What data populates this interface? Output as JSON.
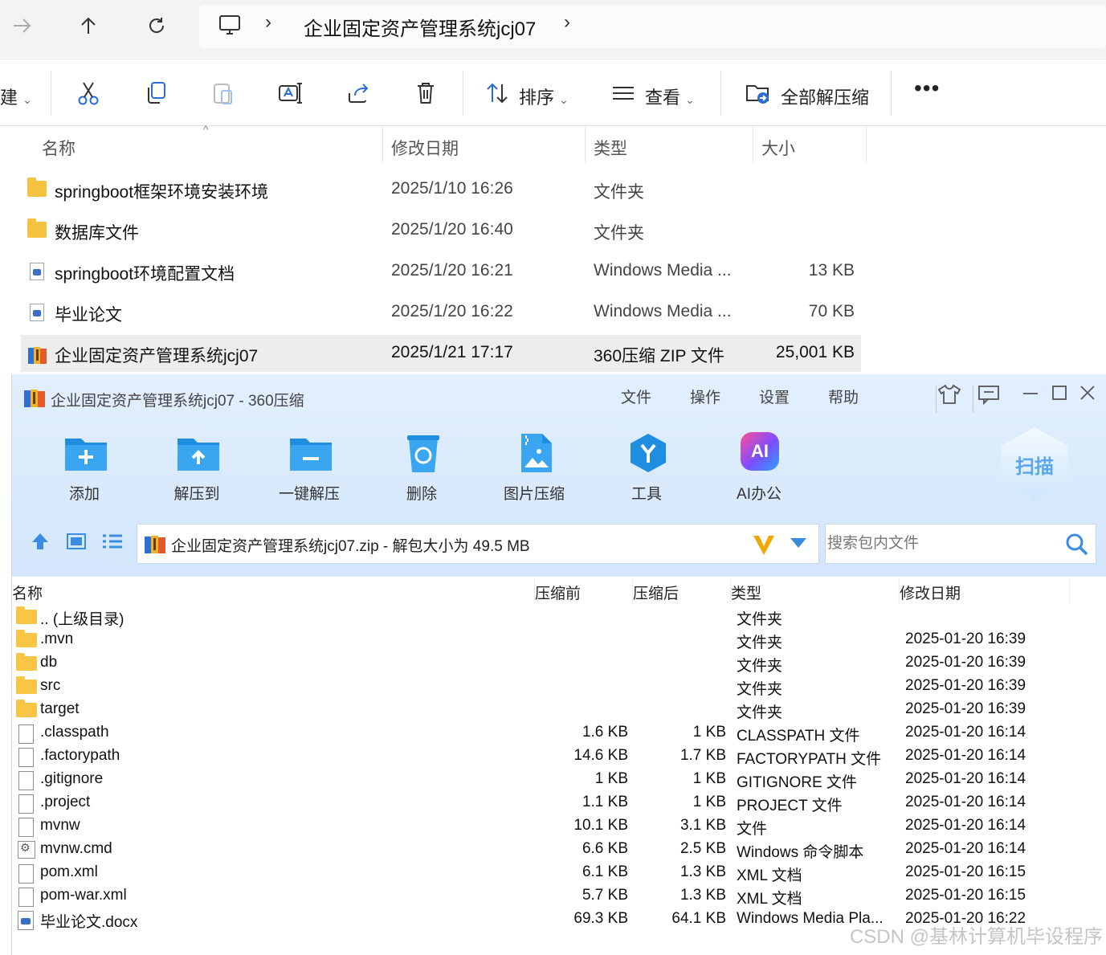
{
  "explorer": {
    "breadcrumb": "企业固定资产管理系统jcj07",
    "toolbar": {
      "new_fragment": "建",
      "sort_label": "排序",
      "view_label": "查看",
      "extract_all_label": "全部解压缩"
    },
    "columns": {
      "name": "名称",
      "modified": "修改日期",
      "type": "类型",
      "size": "大小"
    },
    "rows": [
      {
        "name": "springboot框架环境安装环境",
        "date": "2025/1/10 16:26",
        "type": "文件夹",
        "size": "",
        "icon": "folder-icon"
      },
      {
        "name": "数据库文件",
        "date": "2025/1/20 16:40",
        "type": "文件夹",
        "size": "",
        "icon": "folder-icon"
      },
      {
        "name": "springboot环境配置文档",
        "date": "2025/1/20 16:21",
        "type": "Windows Media ...",
        "size": "13 KB",
        "icon": "document-icon"
      },
      {
        "name": "毕业论文",
        "date": "2025/1/20 16:22",
        "type": "Windows Media ...",
        "size": "70 KB",
        "icon": "document-icon"
      },
      {
        "name": "企业固定资产管理系统jcj07",
        "date": "2025/1/21 17:17",
        "type": "360压缩 ZIP 文件",
        "size": "25,001 KB",
        "icon": "zip-archive-icon",
        "selected": true
      }
    ]
  },
  "zip": {
    "title": "企业固定资产管理系统jcj07 - 360压缩",
    "menu": [
      "文件",
      "操作",
      "设置",
      "帮助"
    ],
    "actions": [
      {
        "label": "添加",
        "icon": "add-folder-icon"
      },
      {
        "label": "解压到",
        "icon": "extract-to-icon"
      },
      {
        "label": "一键解压",
        "icon": "one-click-extract-icon"
      },
      {
        "label": "删除",
        "icon": "delete-icon"
      },
      {
        "label": "图片压缩",
        "icon": "image-compress-icon"
      },
      {
        "label": "工具",
        "icon": "tools-icon"
      },
      {
        "label": "AI办公",
        "icon": "ai-office-icon"
      }
    ],
    "ai_badge": "AI",
    "scan_label": "扫描",
    "path_text": "企业固定资产管理系统jcj07.zip - 解包大小为 49.5 MB",
    "search_placeholder": "搜索包内文件",
    "columns": {
      "name": "名称",
      "before": "压缩前",
      "after": "压缩后",
      "type": "类型",
      "modified": "修改日期"
    },
    "rows": [
      {
        "name": ".. (上级目录)",
        "before": "",
        "after": "",
        "type": "文件夹",
        "date": "",
        "icon": "folder-icon"
      },
      {
        "name": ".mvn",
        "before": "",
        "after": "",
        "type": "文件夹",
        "date": "2025-01-20 16:39",
        "icon": "folder-icon"
      },
      {
        "name": "db",
        "before": "",
        "after": "",
        "type": "文件夹",
        "date": "2025-01-20 16:39",
        "icon": "folder-icon"
      },
      {
        "name": "src",
        "before": "",
        "after": "",
        "type": "文件夹",
        "date": "2025-01-20 16:39",
        "icon": "folder-icon"
      },
      {
        "name": "target",
        "before": "",
        "after": "",
        "type": "文件夹",
        "date": "2025-01-20 16:39",
        "icon": "folder-icon"
      },
      {
        "name": ".classpath",
        "before": "1.6 KB",
        "after": "1 KB",
        "type": "CLASSPATH 文件",
        "date": "2025-01-20 16:14",
        "icon": "file-icon"
      },
      {
        "name": ".factorypath",
        "before": "14.6 KB",
        "after": "1.7 KB",
        "type": "FACTORYPATH 文件",
        "date": "2025-01-20 16:14",
        "icon": "file-icon"
      },
      {
        "name": ".gitignore",
        "before": "1 KB",
        "after": "1 KB",
        "type": "GITIGNORE 文件",
        "date": "2025-01-20 16:14",
        "icon": "file-icon"
      },
      {
        "name": ".project",
        "before": "1.1 KB",
        "after": "1 KB",
        "type": "PROJECT 文件",
        "date": "2025-01-20 16:14",
        "icon": "file-icon"
      },
      {
        "name": "mvnw",
        "before": "10.1 KB",
        "after": "3.1 KB",
        "type": "文件",
        "date": "2025-01-20 16:14",
        "icon": "file-icon"
      },
      {
        "name": "mvnw.cmd",
        "before": "6.6 KB",
        "after": "2.5 KB",
        "type": "Windows 命令脚本",
        "date": "2025-01-20 16:14",
        "icon": "command-script-icon"
      },
      {
        "name": "pom.xml",
        "before": "6.1 KB",
        "after": "1.3 KB",
        "type": "XML 文档",
        "date": "2025-01-20 16:15",
        "icon": "file-icon"
      },
      {
        "name": "pom-war.xml",
        "before": "5.7 KB",
        "after": "1.3 KB",
        "type": "XML 文档",
        "date": "2025-01-20 16:15",
        "icon": "file-icon"
      },
      {
        "name": "毕业论文.docx",
        "before": "69.3 KB",
        "after": "64.1 KB",
        "type": "Windows Media Pla...",
        "date": "2025-01-20 16:22",
        "icon": "document-icon"
      }
    ]
  },
  "watermark": "CSDN @基林计算机毕设程序"
}
